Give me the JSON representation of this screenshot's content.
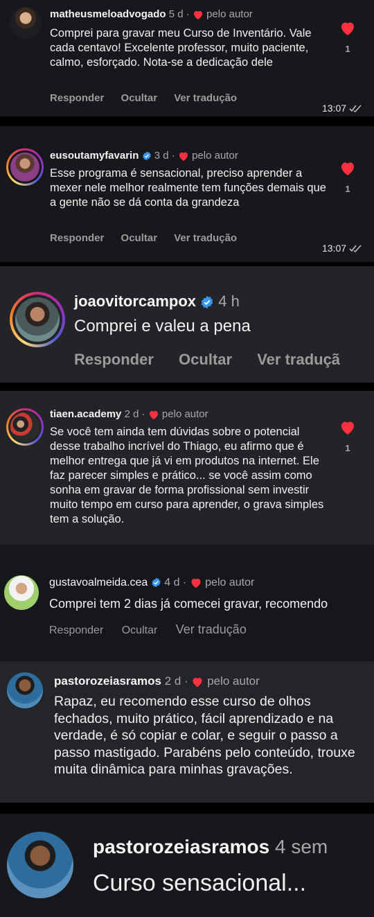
{
  "comments": [
    {
      "username": "matheusmeloadvogado",
      "age": "5 d ·",
      "author_liked": "pelo autor",
      "text": "Comprei para gravar meu Curso de Inventário. Vale cada centavo! Excelente professor, muito paciente, calmo, esforçado. Nota-se a dedicação dele",
      "actions": {
        "reply": "Responder",
        "hide": "Ocultar",
        "translate": "Ver tradução"
      },
      "likes": "1",
      "time": "13:07"
    },
    {
      "username": "eusoutamyfavarin",
      "age": "3 d ·",
      "author_liked": "pelo autor",
      "text": "Esse programa é sensacional, preciso aprender a mexer nele melhor realmente tem funções demais que a gente não se dá conta da grandeza",
      "actions": {
        "reply": "Responder",
        "hide": "Ocultar",
        "translate": "Ver tradução"
      },
      "likes": "1",
      "time": "13:07"
    },
    {
      "username": "joaovitorcampox",
      "age": "4 h",
      "text": "Comprei e valeu a pena",
      "actions": {
        "reply": "Responder",
        "hide": "Ocultar",
        "translate": "Ver traduçã"
      }
    },
    {
      "username": "tiaen.academy",
      "age": "2 d ·",
      "author_liked": "pelo autor",
      "text": "Se você tem ainda tem dúvidas sobre o potencial desse trabalho incrível do Thiago, eu afirmo que é melhor entrega que já vi em produtos na internet. Ele faz parecer simples e prático... se você assim como sonha em gravar de forma profissional sem investir muito tempo em curso para aprender, o grava simples tem a solução.",
      "likes": "1"
    },
    {
      "username": "gustavoalmeida.cea",
      "age": "4 d ·",
      "author_liked": "pelo autor",
      "text": "Comprei tem 2 dias já comecei gravar, recomendo",
      "actions": {
        "reply": "Responder",
        "hide": "Ocultar",
        "translate": "Ver tradução"
      }
    },
    {
      "username": "pastorozeiasramos",
      "age": "2 d ·",
      "author_liked": "pelo autor",
      "text": "Rapaz, eu recomendo esse curso de olhos fechados, muito prático, fácil aprendizado e na verdade, é só copiar e colar, e seguir o passo a passo mastigado. Parabéns pelo conteúdo, trouxe muita dinâmica para minhas gravações."
    },
    {
      "username": "pastorozeiasramos",
      "age": "4 sem",
      "text": "Curso sensacional..."
    }
  ],
  "colors": {
    "heart": "#ff3040",
    "verified": "#3897f0",
    "card_bg": "#1e2024",
    "card_bg_alt": "#16181c",
    "separator": "#000000"
  },
  "icons": {
    "heart": "heart-icon",
    "verified": "verified-badge-icon",
    "read_check": "double-check-icon"
  }
}
